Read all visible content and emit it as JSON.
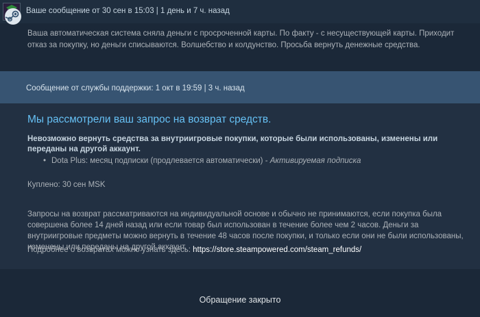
{
  "user_message": {
    "header": "Ваше сообщение от 30 сен в 15:03 | 1 день и 7 ч. назад",
    "body": "Ваша автоматическая система сняла деньги с просроченной карты. По факту - с несуществующей карты. Приходит отказ за покупку, но деньги списываются. Волшебство и колдунство. Просьба вернуть денежные средства."
  },
  "support_message": {
    "header": "Сообщение от службы поддержки: 1 окт в 19:59 | 3 ч. назад",
    "title": "Мы рассмотрели ваш запрос на возврат средств.",
    "notice": "Невозможно вернуть средства за внутриигровые покупки, которые были использованы, изменены или переданы на другой аккаунт.",
    "item_name": "Dota Plus: месяц подписки (продлевается автоматически)",
    "item_separator": " - ",
    "item_status": "Активируемая подписка",
    "purchased": "Куплено: 30 сен MSK",
    "policy": "Запросы на возврат рассматриваются на индивидуальной основе и обычно не принимаются, если покупка была совершена более 14 дней назад или если товар был использован в течение более чем 2 часов. Деньги за внутриигровые предметы можно вернуть в течение 48 часов после покупки, и только если они не были использованы, изменены или переданы на другой аккаунт.",
    "more_prefix": "Подробнее о возвратах можно узнать здесь: ",
    "more_link": "https://store.steampowered.com/steam_refunds/"
  },
  "status": {
    "closed": "Обращение закрыто"
  },
  "colors": {
    "background": "#1b2838",
    "support_header": "#375472",
    "title": "#66c0f4"
  },
  "icons": {
    "avatar": "user-avatar",
    "support": "steam-logo-icon"
  }
}
